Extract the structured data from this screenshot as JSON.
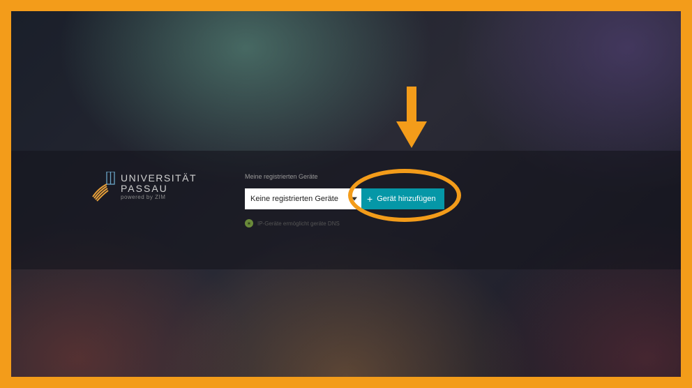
{
  "logo": {
    "line1": "UNIVERSITÄT",
    "line2": "PASSAU",
    "subline": "powered by ZIM"
  },
  "form": {
    "heading": "Meine registrierten Geräte",
    "dropdown_value": "Keine registrierten Geräte",
    "add_button_label": "Gerät hinzufügen",
    "hint_text": "IP-Geräte ermöglicht geräte DNS"
  },
  "colors": {
    "accent_orange": "#f39c1a",
    "button_teal": "#0597a7"
  }
}
